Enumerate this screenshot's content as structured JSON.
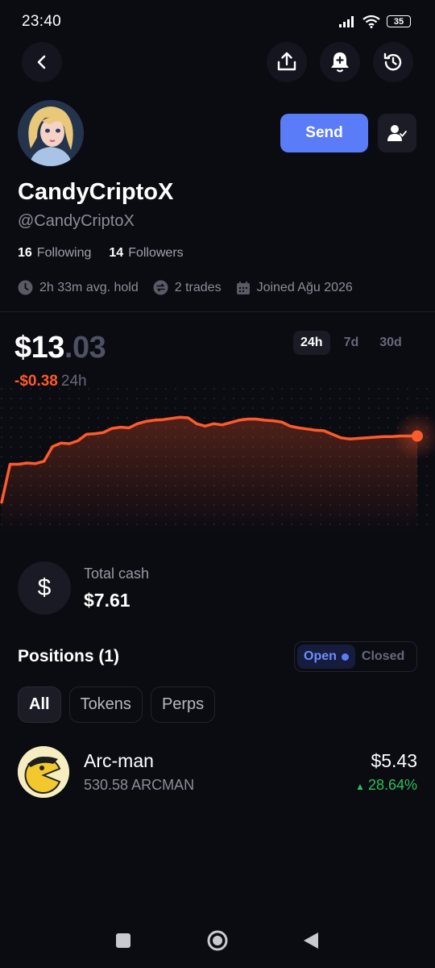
{
  "status_bar": {
    "time": "23:40",
    "battery": "35"
  },
  "profile": {
    "display_name": "CandyCriptoX",
    "handle": "@CandyCriptoX",
    "following_count": "16",
    "following_label": "Following",
    "followers_count": "14",
    "followers_label": "Followers",
    "avg_hold": "2h 33m avg. hold",
    "trades": "2 trades",
    "joined": "Joined Ağu 2026",
    "send_label": "Send"
  },
  "balance": {
    "integer": "$13",
    "decimal": ".03",
    "change": "-$0.38",
    "change_period": "24h"
  },
  "range_tabs": [
    {
      "label": "24h",
      "active": true
    },
    {
      "label": "7d",
      "active": false
    },
    {
      "label": "30d",
      "active": false
    }
  ],
  "chart_data": {
    "type": "line",
    "series": [
      {
        "values": [
          11.9,
          12.55,
          12.55,
          12.57,
          12.56,
          12.6,
          12.85,
          12.91,
          12.9,
          12.95,
          13.06,
          13.07,
          13.09,
          13.16,
          13.18,
          13.17,
          13.24,
          13.28,
          13.3,
          13.31,
          13.33,
          13.35,
          13.34,
          13.24,
          13.2,
          13.24,
          13.22,
          13.26,
          13.3,
          13.32,
          13.32,
          13.3,
          13.29,
          13.27,
          13.2,
          13.17,
          13.15,
          13.13,
          13.12,
          13.06,
          13.0,
          12.98,
          12.99,
          13.0,
          13.01,
          13.02,
          13.02,
          13.03,
          13.03,
          13.03
        ]
      }
    ],
    "color": "#ff5a2b"
  },
  "cash": {
    "label": "Total cash",
    "value": "$7.61",
    "icon": "dollar-icon"
  },
  "positions": {
    "title": "Positions (1)",
    "toggle": {
      "open": "Open",
      "closed": "Closed"
    },
    "filters": [
      "All",
      "Tokens",
      "Perps"
    ],
    "items": [
      {
        "name": "Arc-man",
        "amount": "530.58 ARCMAN",
        "value": "$5.43",
        "change": "28.64%"
      }
    ]
  }
}
